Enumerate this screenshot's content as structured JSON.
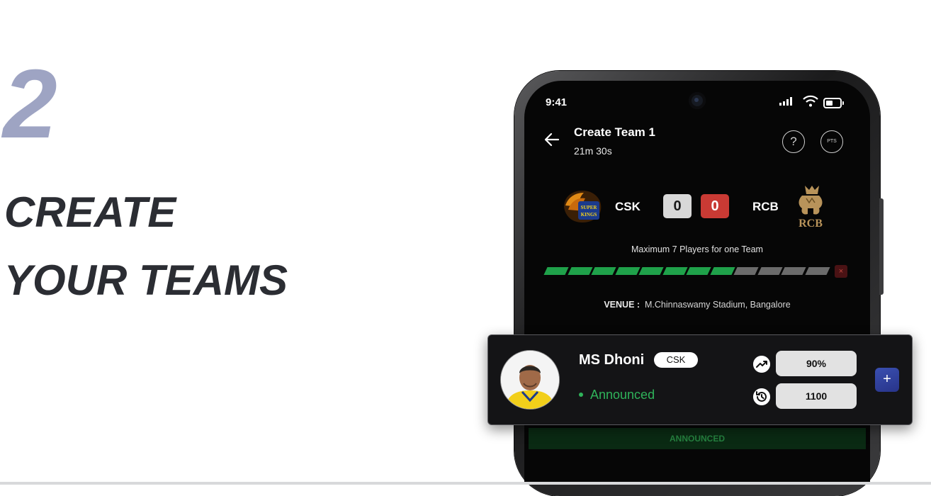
{
  "hero": {
    "step_number": "2",
    "line1": "CREATE",
    "line2": "YOUR TEAMS"
  },
  "status_bar": {
    "time": "9:41"
  },
  "header": {
    "title": "Create Team 1",
    "timer": "21m 30s",
    "help_label": "?",
    "points_label": "PTS"
  },
  "match": {
    "team1": "CSK",
    "team1_score": "0",
    "team2": "RCB",
    "team2_score": "0"
  },
  "selection": {
    "message": "Maximum 7 Players for one Team",
    "selected_segments": 8,
    "total_segments": 12,
    "clear_label": "×"
  },
  "venue": {
    "label": "VENUE :",
    "name": "M.Chinnaswamy Stadium, Bangalore"
  },
  "player": {
    "name": "MS Dhoni",
    "team": "CSK",
    "status": "Announced",
    "selected_by": "90%",
    "credits": "1100",
    "add_label": "+"
  },
  "footer_bar": {
    "label": "ANNOUNCED"
  },
  "colors": {
    "accent_green": "#2fb35a",
    "score_red": "#c93a34",
    "hero_number": "#9ea4c3",
    "add_button": "#3a4fb0"
  },
  "icons": [
    "back-arrow-icon",
    "help-icon",
    "points-icon",
    "signal-icon",
    "wifi-icon",
    "battery-icon",
    "trending-icon",
    "history-icon",
    "plus-icon",
    "close-icon"
  ]
}
